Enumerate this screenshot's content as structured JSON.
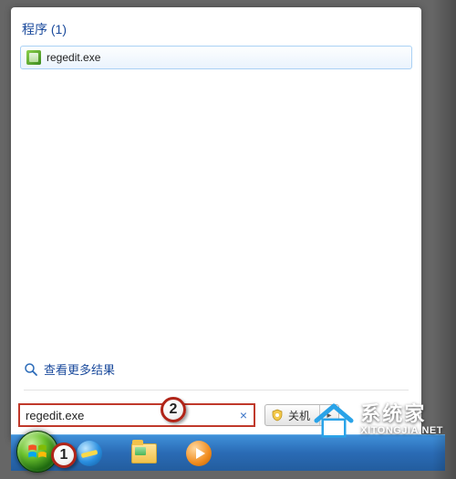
{
  "programs": {
    "header": "程序 (1)",
    "items": [
      {
        "label": "regedit.exe",
        "icon": "regedit-icon"
      }
    ]
  },
  "more_results": {
    "label": "查看更多结果"
  },
  "search": {
    "value": "regedit.exe",
    "clear_glyph": "×"
  },
  "shutdown": {
    "label": "关机",
    "arrow": "▸"
  },
  "annotations": {
    "n1": "1",
    "n2": "2"
  },
  "watermark": {
    "cn": "系统家",
    "url": "XITONGJIA.NET"
  }
}
